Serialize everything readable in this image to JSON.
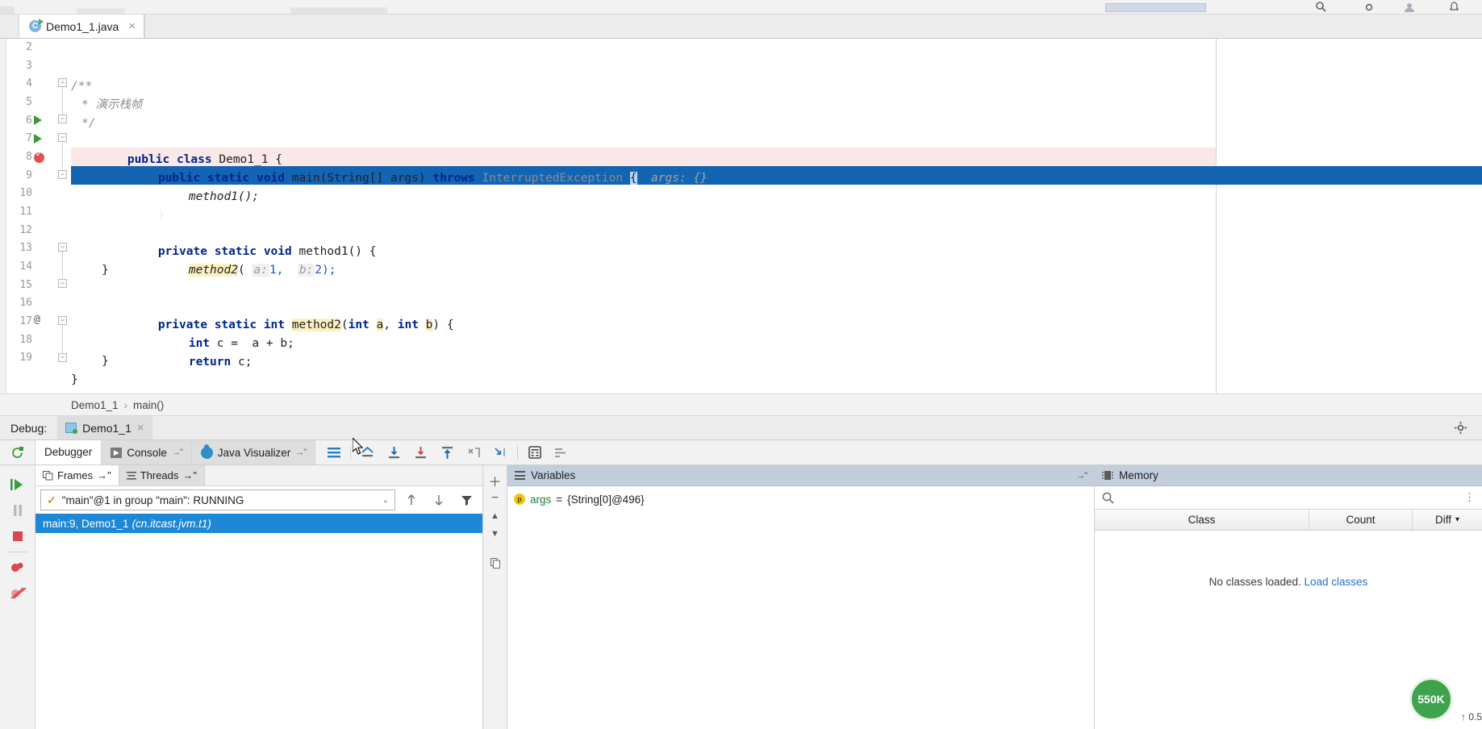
{
  "window": {
    "editor_tab": {
      "filename": "Demo1_1.java",
      "icon": "java-class-icon",
      "close": "×"
    }
  },
  "editor": {
    "lines": [
      {
        "n": "2",
        "text": ""
      },
      {
        "n": "3",
        "text": "/**"
      },
      {
        "n": "4",
        "text": " * 演示栈帧"
      },
      {
        "n": "5",
        "text": " */"
      },
      {
        "n": "6",
        "text": "public class Demo1_1 {"
      },
      {
        "n": "7",
        "text": "    public static void main(String[] args) throws InterruptedException {"
      },
      {
        "n": "8",
        "text": "        method1();"
      },
      {
        "n": "9",
        "text": "    }"
      },
      {
        "n": "10",
        "text": ""
      },
      {
        "n": "11",
        "text": "    private static void method1() {"
      },
      {
        "n": "12",
        "text": "        method2( a: 1,  b: 2);"
      },
      {
        "n": "13",
        "text": "    }"
      },
      {
        "n": "14",
        "text": ""
      },
      {
        "n": "15",
        "text": "    private static int method2(int a, int b) {"
      },
      {
        "n": "16",
        "text": "        int c =  a + b;"
      },
      {
        "n": "17",
        "text": "        return c;"
      },
      {
        "n": "18",
        "text": "    }"
      },
      {
        "n": "19",
        "text": "}"
      }
    ],
    "tokens": {
      "kw_public": "public",
      "kw_class": "class",
      "kw_static": "static",
      "kw_void": "void",
      "kw_private": "private",
      "kw_int": "int",
      "kw_throws": "throws",
      "kw_return": "return",
      "cls_name": "Demo1_1",
      "main": "main",
      "string_args": "(String[] args)",
      "exception": "InterruptedException",
      "open_brace": "{",
      "close_brace": "}",
      "comment_open": "/**",
      "comment_body": "* 演示栈帧",
      "comment_close": "*/",
      "method1_call": "method1();",
      "method1_decl": "method1() {",
      "method2_name": "method2",
      "method2_decl_tail": "(int a, int b) {",
      "hint_a": "a:",
      "hint_b": "b:",
      "val_1": "1,",
      "val_2": "2);",
      "line16": "c =  a + b;",
      "line16_kw": "int",
      "line17_val": "c;",
      "inline_hint_args": "args: {}"
    },
    "markers": {
      "run_line6": "run-gutter-icon",
      "run_line7": "run-gutter-icon",
      "breakpoint_line8": "breakpoint-verified-icon",
      "at_line15": "@"
    }
  },
  "breadcrumb": {
    "class": "Demo1_1",
    "sep": "›",
    "method": "main()"
  },
  "debug_header": {
    "label": "Debug:",
    "run_config": "Demo1_1",
    "close": "×",
    "settings_icon": "gear-icon"
  },
  "debug_tabs": [
    {
      "label": "Debugger",
      "icon": null,
      "active": true,
      "pin": ""
    },
    {
      "label": "Console",
      "icon": "console-icon",
      "active": false,
      "pin": "→\""
    },
    {
      "label": "Java Visualizer",
      "icon": "java-visualizer-icon",
      "active": false,
      "pin": "→\""
    }
  ],
  "debug_toolbar_icons": [
    "layout-settings-icon",
    "show-execution-point-icon",
    "step-over-icon",
    "step-into-icon",
    "force-step-into-icon",
    "step-out-icon",
    "drop-frame-icon",
    "run-to-cursor-icon",
    "evaluate-expression-icon",
    "mute-breakpoints-icon"
  ],
  "side_buttons": [
    "rerun-icon",
    "resume-program-icon",
    "pause-program-icon",
    "stop-icon",
    "view-breakpoints-icon",
    "mute-breakpoints-icon"
  ],
  "frames_panel": {
    "tabs": [
      {
        "label": "Frames",
        "icon": "frames-icon",
        "pin": "→\"",
        "active": true
      },
      {
        "label": "Threads",
        "icon": "threads-icon",
        "pin": "→\"",
        "active": false
      }
    ],
    "thread_selector": {
      "value": "\"main\"@1 in group \"main\": RUNNING",
      "check": "✓",
      "caret": "⌄"
    },
    "toolbar_icons": [
      "arrow-up-icon",
      "arrow-down-icon",
      "filter-icon"
    ],
    "frames": [
      {
        "text": "main:9, Demo1_1 ",
        "location": "(cn.itcast.jvm.t1)",
        "selected": true
      }
    ],
    "side_icons": [
      "plus-icon",
      "minus-icon",
      "move-up-icon",
      "move-down-icon",
      "copy-icon"
    ]
  },
  "variables_panel": {
    "title": "Variables",
    "icon": "variables-icon",
    "pin": "→\"",
    "rows": [
      {
        "badge": "p",
        "name": "args",
        "eq": "=",
        "value": "{String[0]@496}"
      }
    ]
  },
  "memory_panel": {
    "title": "Memory",
    "icon": "memory-icon",
    "search_placeholder": "",
    "search_value": "",
    "search_icon": "search-icon",
    "columns": [
      "Class",
      "Count",
      "Diff"
    ],
    "diff_caret": "▾",
    "empty_text": "No classes loaded.",
    "empty_link": "Load classes"
  },
  "status_overlay": {
    "badge": "550K",
    "arrow": "↑",
    "value": "0.5"
  },
  "colors": {
    "selection_blue": "#1464b4",
    "breakpoint_row": "#fae7e7",
    "keyword": "#00258c",
    "comment": "#8c8c8c",
    "panel_header": "#c3cedd",
    "frame_selected": "#1e88d6",
    "link": "#2a6fc9"
  }
}
